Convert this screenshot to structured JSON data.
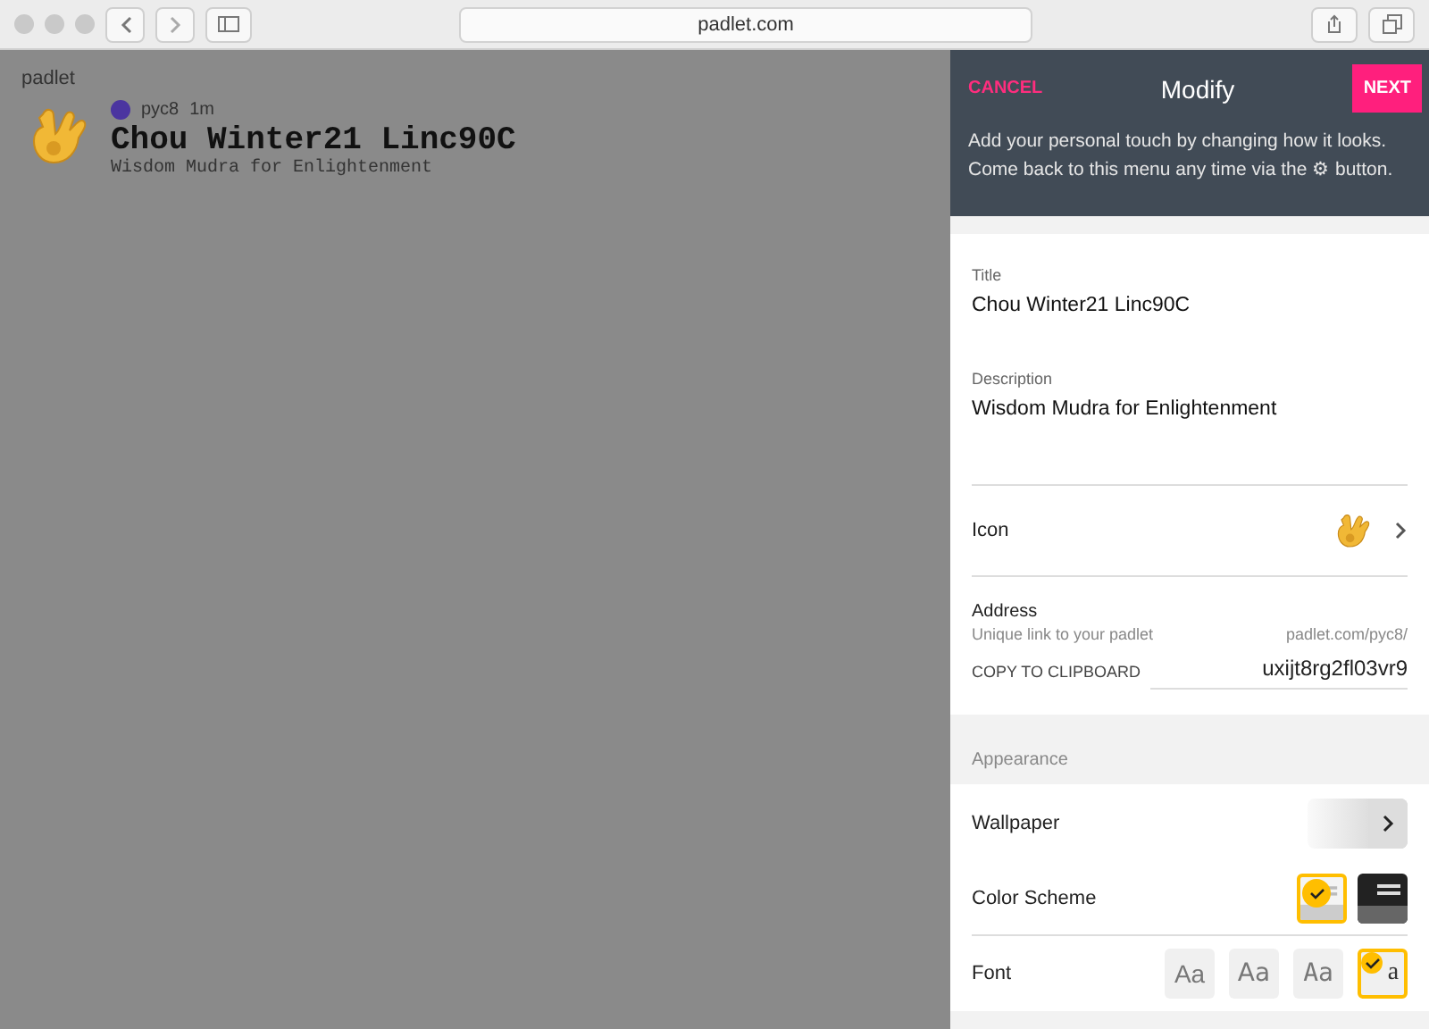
{
  "browser": {
    "url": "padlet.com"
  },
  "board": {
    "brand": "padlet",
    "author": "pyc8",
    "time": "1m",
    "title": "Chou Winter21 Linc90C",
    "description": "Wisdom Mudra for Enlightenment"
  },
  "panel": {
    "cancel": "CANCEL",
    "title": "Modify",
    "next": "NEXT",
    "intro": "Add your personal touch by changing how it looks. Come back to this menu any time via the ⚙ button.",
    "title_label": "Title",
    "title_value": "Chou Winter21 Linc90C",
    "description_label": "Description",
    "description_value": "Wisdom Mudra for Enlightenment",
    "icon_label": "Icon",
    "address_label": "Address",
    "address_hint": "Unique link to your padlet",
    "address_prefix": "padlet.com/pyc8/",
    "copy": "COPY TO CLIPBOARD",
    "address_slug": "uxijt8rg2fl03vr9",
    "appearance": "Appearance",
    "wallpaper_label": "Wallpaper",
    "scheme_label": "Color Scheme",
    "schemes": [
      {
        "kind": "light",
        "selected": true
      },
      {
        "kind": "dark",
        "selected": false
      }
    ],
    "font_label": "Font",
    "fonts": [
      {
        "label": "Aa",
        "kind": "sans",
        "selected": false
      },
      {
        "label": "Aa",
        "kind": "light",
        "selected": false
      },
      {
        "label": "Aa",
        "kind": "narrow",
        "selected": false
      },
      {
        "label": "a",
        "kind": "serif",
        "selected": true
      }
    ]
  }
}
